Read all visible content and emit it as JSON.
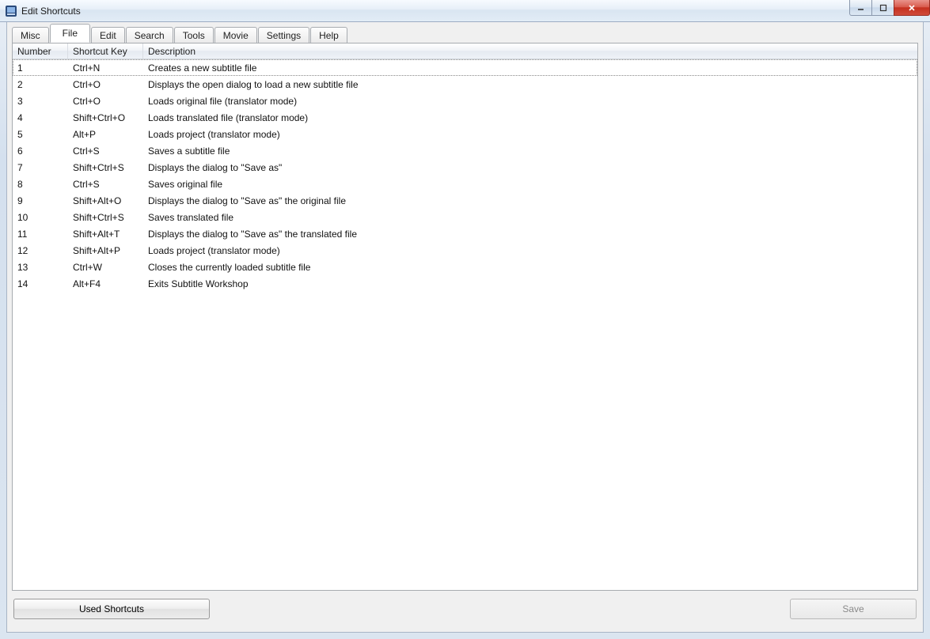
{
  "window": {
    "title": "Edit Shortcuts"
  },
  "tabs": [
    "Misc",
    "File",
    "Edit",
    "Search",
    "Tools",
    "Movie",
    "Settings",
    "Help"
  ],
  "active_tab_index": 1,
  "columns": {
    "number": "Number",
    "shortcut": "Shortcut Key",
    "description": "Description"
  },
  "rows": [
    {
      "num": "1",
      "key": "Ctrl+N",
      "desc": "Creates a new subtitle file"
    },
    {
      "num": "2",
      "key": "Ctrl+O",
      "desc": "Displays the open dialog to load a new subtitle file"
    },
    {
      "num": "3",
      "key": "Ctrl+O",
      "desc": "Loads original file (translator mode)"
    },
    {
      "num": "4",
      "key": "Shift+Ctrl+O",
      "desc": "Loads translated file (translator mode)"
    },
    {
      "num": "5",
      "key": "Alt+P",
      "desc": "Loads project (translator mode)"
    },
    {
      "num": "6",
      "key": "Ctrl+S",
      "desc": "Saves a subtitle file"
    },
    {
      "num": "7",
      "key": "Shift+Ctrl+S",
      "desc": "Displays the dialog to \"Save as\""
    },
    {
      "num": "8",
      "key": "Ctrl+S",
      "desc": "Saves original file"
    },
    {
      "num": "9",
      "key": "Shift+Alt+O",
      "desc": "Displays the dialog to \"Save as\" the original file"
    },
    {
      "num": "10",
      "key": "Shift+Ctrl+S",
      "desc": "Saves translated file"
    },
    {
      "num": "11",
      "key": "Shift+Alt+T",
      "desc": "Displays the dialog to \"Save as\" the translated file"
    },
    {
      "num": "12",
      "key": "Shift+Alt+P",
      "desc": "Loads project (translator mode)"
    },
    {
      "num": "13",
      "key": "Ctrl+W",
      "desc": "Closes the currently loaded subtitle file"
    },
    {
      "num": "14",
      "key": "Alt+F4",
      "desc": "Exits Subtitle Workshop"
    }
  ],
  "buttons": {
    "used_shortcuts": "Used Shortcuts",
    "save": "Save"
  }
}
